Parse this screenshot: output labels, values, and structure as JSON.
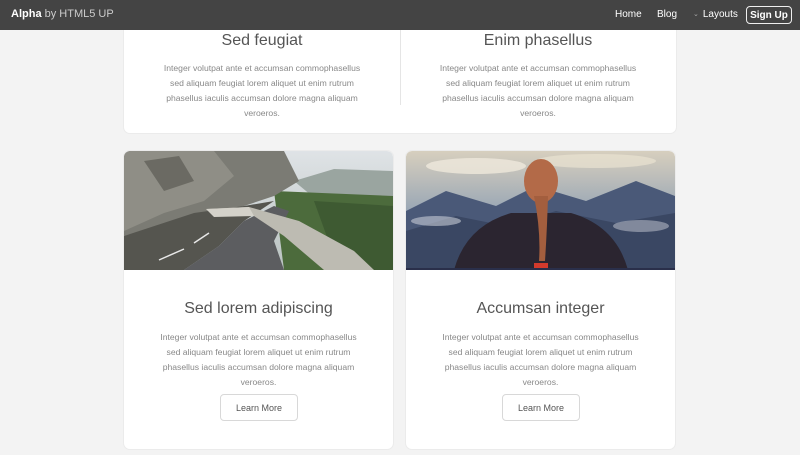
{
  "header": {
    "brand_name": "Alpha",
    "brand_by": "by HTML5 UP",
    "nav": {
      "home": "Home",
      "blog": "Blog",
      "layouts": "Layouts",
      "signup": "Sign Up"
    }
  },
  "top_section": {
    "features": [
      {
        "title": "Sed feugiat",
        "body": "Integer volutpat ante et accumsan commophasellus sed aliquam feugiat lorem aliquet ut enim rutrum phasellus iaculis accumsan dolore magna aliquam veroeros."
      },
      {
        "title": "Enim phasellus",
        "body": "Integer volutpat ante et accumsan commophasellus sed aliquam feugiat lorem aliquet ut enim rutrum phasellus iaculis accumsan dolore magna aliquam veroeros."
      }
    ]
  },
  "cards": [
    {
      "image": "mountain-road-photo",
      "title": "Sed lorem adipiscing",
      "body": "Integer volutpat ante et accumsan commophasellus sed aliquam feugiat lorem aliquet ut enim rutrum phasellus iaculis accumsan dolore magna aliquam veroeros.",
      "button": "Learn More"
    },
    {
      "image": "woman-braid-mountains-photo",
      "title": "Accumsan integer",
      "body": "Integer volutpat ante et accumsan commophasellus sed aliquam feugiat lorem aliquet ut enim rutrum phasellus iaculis accumsan dolore magna aliquam veroeros.",
      "button": "Learn More"
    }
  ],
  "colors": {
    "header_bg": "#444444",
    "page_bg": "#f3f3f3",
    "card_bg": "#ffffff"
  }
}
